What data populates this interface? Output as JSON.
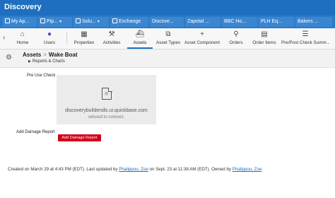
{
  "topbar": {
    "brand": "Discovery"
  },
  "apps": [
    {
      "label": "My Ap..."
    },
    {
      "label": "Pip..."
    },
    {
      "label": "Solu..."
    },
    {
      "label": "Exchange"
    },
    {
      "label": "Discove..."
    },
    {
      "label": "Zapotal ..."
    },
    {
      "label": "BBC Ho..."
    },
    {
      "label": "PLH Eq..."
    },
    {
      "label": "Bakers ..."
    }
  ],
  "nav": {
    "items": [
      {
        "label": "Home",
        "icon": "home-icon"
      },
      {
        "label": "Users",
        "icon": "users-icon"
      },
      {
        "label": "Properties",
        "icon": "building-icon"
      },
      {
        "label": "Activities",
        "icon": "activities-icon"
      },
      {
        "label": "Assets",
        "icon": "boat-icon",
        "active": true
      },
      {
        "label": "Asset Types",
        "icon": "asset-types-icon"
      },
      {
        "label": "Asset Component",
        "icon": "plus-icon"
      },
      {
        "label": "Orders",
        "icon": "tag-icon"
      },
      {
        "label": "Order Items",
        "icon": "order-items-icon"
      },
      {
        "label": "Pre/Post Check Summ...",
        "icon": "checklist-icon"
      }
    ]
  },
  "page": {
    "breadcrumb_root": "Assets",
    "breadcrumb_sep": ">",
    "title": "Wake Boat",
    "subnav": "Reports & Charts"
  },
  "form": {
    "pre_use_label": "Pre Use Check",
    "embed_host": "discoverybuildersllc.ui.quickbase.com",
    "embed_message": "refused to connect.",
    "damage_label": "Add Damage Report",
    "damage_button": "Add Damage Report"
  },
  "footer": {
    "created": "Created on March 29 at  4:43 PM (EDT). Last updated by ",
    "updated_by": "Phalippou, Zoe",
    "updated_on": " on Sept. 23 at 11:38 AM (EDT). Owned by ",
    "owner": "Phalippou, Zoe",
    "end": "."
  }
}
